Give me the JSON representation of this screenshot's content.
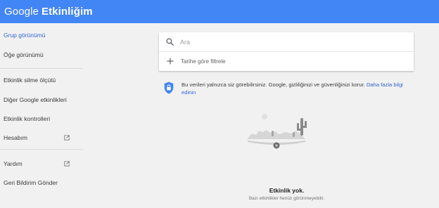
{
  "header": {
    "brand_google": "Google",
    "brand_product": "Etkinliğim",
    "bar_color": "#4285f4"
  },
  "sidebar": {
    "items": [
      {
        "label": "Grup görünümü",
        "active": true
      },
      {
        "label": "Öğe görünümü",
        "active": false
      },
      {
        "label": "Etkinlik silme ölçütü",
        "active": false
      },
      {
        "label": "Diğer Google etkinlikleri",
        "active": false
      },
      {
        "label": "Etkinlik kontrolleri",
        "active": false
      },
      {
        "label": "Hesabım",
        "active": false,
        "icon": "open-in-new-icon"
      },
      {
        "label": "Yardım",
        "active": false,
        "icon": "open-in-new-icon"
      },
      {
        "label": "Geri Bildirim Gönder",
        "active": false
      }
    ],
    "active_color": "#3367d6"
  },
  "search": {
    "placeholder": "Ara",
    "icon": "search-icon",
    "filter_label": "Tarihe göre filtrele",
    "filter_icon": "plus-icon"
  },
  "privacy": {
    "icon": "shield-lock-icon",
    "text": "Bu verileri yalnızca siz görebilirsiniz. Google, gizliliğinizi ve güvenliğinizi korur. ",
    "link": "Daha fazla bilgi edinin"
  },
  "empty_state": {
    "illustration": "desert-cactus-illustration",
    "title": "Etkinlik yok.",
    "subtitle": "Bazı etkinlikler henüz görünmeyebilir."
  }
}
